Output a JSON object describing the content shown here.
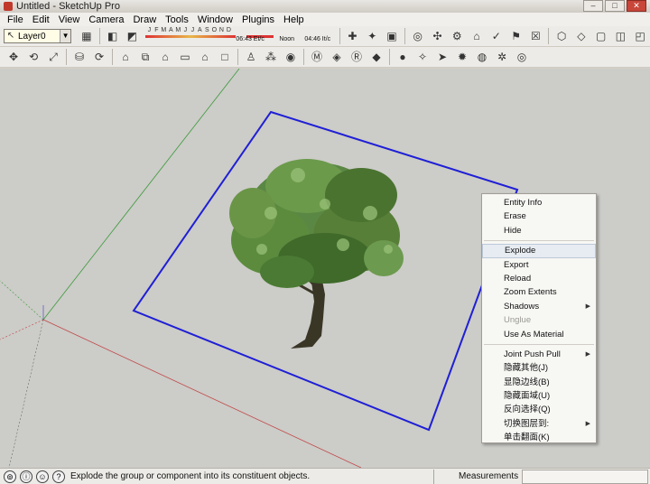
{
  "window": {
    "title": "Untitled - SketchUp Pro",
    "controls": [
      "–",
      "□",
      "✕"
    ]
  },
  "menubar": {
    "items": [
      "File",
      "Edit",
      "View",
      "Camera",
      "Draw",
      "Tools",
      "Window",
      "Plugins",
      "Help"
    ]
  },
  "toolbar1": {
    "layer_value": "Layer0",
    "shadow_months": [
      "J",
      "F",
      "M",
      "A",
      "M",
      "J",
      "J",
      "A",
      "S",
      "O",
      "N",
      "D"
    ],
    "shadow_time_1": "06:43 Et/c",
    "shadow_time_noon": "Noon",
    "shadow_time_2": "04:46 It/c"
  },
  "context_menu": {
    "items": [
      {
        "label": "Entity Info"
      },
      {
        "label": "Erase"
      },
      {
        "label": "Hide"
      },
      {
        "label": "Explode"
      },
      {
        "label": "Export"
      },
      {
        "label": "Reload"
      },
      {
        "label": "Zoom Extents"
      },
      {
        "label": "Shadows"
      },
      {
        "label": "Unglue"
      },
      {
        "label": "Use As Material"
      },
      {
        "label": "Joint Push Pull"
      },
      {
        "label": "隐藏其他(J)"
      },
      {
        "label": "显隐边线(B)"
      },
      {
        "label": "隐藏面域(U)"
      },
      {
        "label": "反向选择(Q)"
      },
      {
        "label": "切换图层到:"
      },
      {
        "label": "单击翻面(K)"
      }
    ]
  },
  "statusbar": {
    "hint": "Explode the group or component into its constituent objects.",
    "measurements_label": "Measurements",
    "measurements_value": ""
  },
  "colors": {
    "selection_blue": "#1f1fd6",
    "axis_green": "#3c9a3c",
    "axis_red": "#c04848",
    "canvas_bg": "#ccccc8",
    "tree_foliage": "#4f7f35",
    "tree_trunk": "#3a3626"
  }
}
